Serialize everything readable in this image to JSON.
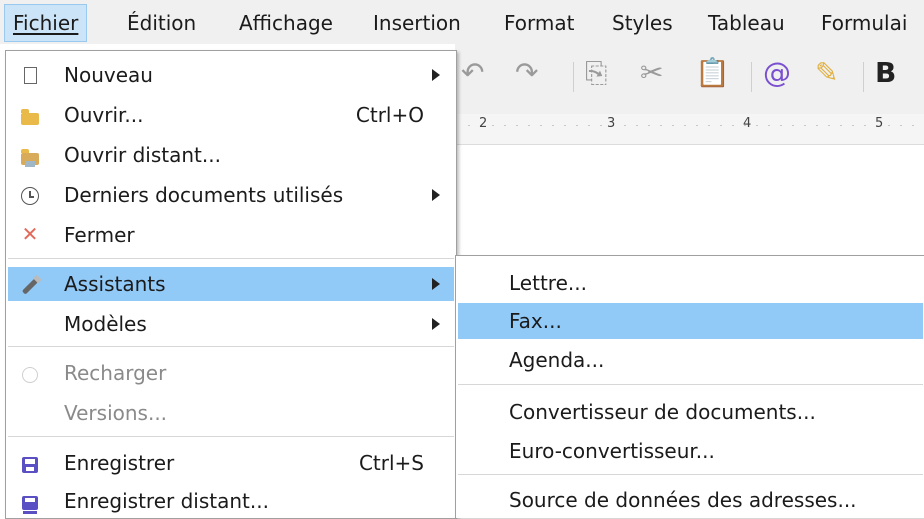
{
  "menubar": {
    "items": [
      "Fichier",
      "Édition",
      "Affichage",
      "Insertion",
      "Format",
      "Styles",
      "Tableau",
      "Formulai"
    ]
  },
  "ruler": {
    "numbers": [
      "2",
      "3",
      "4",
      "5"
    ]
  },
  "file_menu": {
    "items": [
      {
        "label": "Nouveau",
        "icon": "new-document-icon",
        "submenu": true
      },
      {
        "label": "Ouvrir...",
        "icon": "open-folder-icon",
        "shortcut": "Ctrl+O"
      },
      {
        "label": "Ouvrir distant...",
        "icon": "open-remote-icon"
      },
      {
        "label": "Derniers documents utilisés",
        "icon": "recent-clock-icon",
        "submenu": true
      },
      {
        "label": "Fermer",
        "icon": "close-icon"
      },
      {
        "label": "Assistants",
        "icon": "wizard-wand-icon",
        "submenu": true,
        "highlighted": true
      },
      {
        "label": "Modèles",
        "submenu": true
      },
      {
        "label": "Recharger",
        "icon": "reload-icon",
        "disabled": true
      },
      {
        "label": "Versions...",
        "disabled": true
      },
      {
        "label": "Enregistrer",
        "icon": "save-icon",
        "shortcut": "Ctrl+S"
      },
      {
        "label": "Enregistrer distant...",
        "icon": "save-remote-icon"
      }
    ]
  },
  "wizards_submenu": {
    "items": [
      {
        "label": "Lettre..."
      },
      {
        "label": "Fax...",
        "highlighted": true
      },
      {
        "label": "Agenda..."
      },
      {
        "label": "Convertisseur de documents..."
      },
      {
        "label": "Euro-convertisseur..."
      },
      {
        "label": "Source de données des adresses..."
      }
    ]
  },
  "colors": {
    "highlight": "#91c9f7",
    "menubar_active": "#cce4f7",
    "disabled_text": "#8a8a8a"
  }
}
